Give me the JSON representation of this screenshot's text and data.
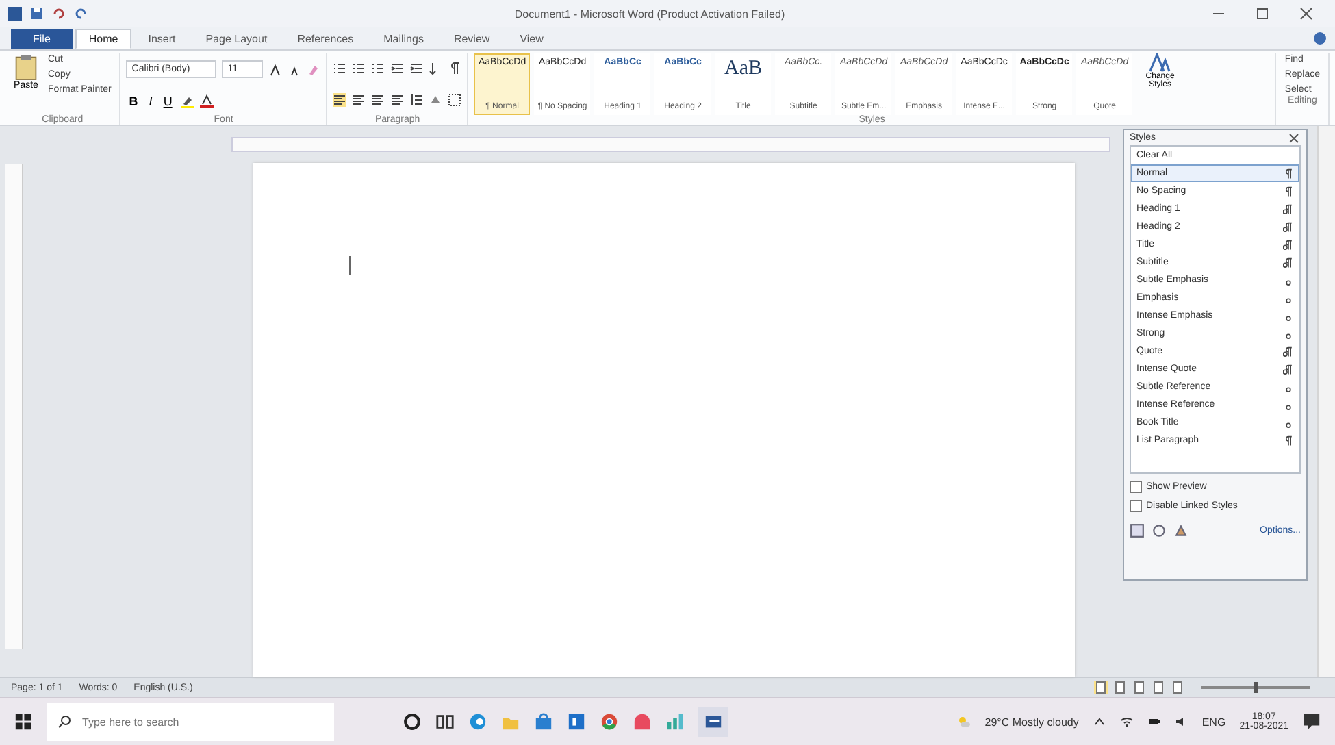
{
  "window": {
    "title": "Document1 - Microsoft Word (Product Activation Failed)"
  },
  "file_tab": "File",
  "tabs": [
    {
      "label": "Home",
      "selected": true
    },
    {
      "label": "Insert",
      "selected": false
    },
    {
      "label": "Page Layout",
      "selected": false
    },
    {
      "label": "References",
      "selected": false
    },
    {
      "label": "Mailings",
      "selected": false
    },
    {
      "label": "Review",
      "selected": false
    },
    {
      "label": "View",
      "selected": false
    }
  ],
  "clipboard": {
    "paste": "Paste",
    "cut": "Cut",
    "copy": "Copy",
    "format_painter": "Format Painter",
    "label": "Clipboard"
  },
  "font": {
    "family": "Calibri (Body)",
    "size": "11",
    "formats": [
      "B",
      "I",
      "U"
    ],
    "label": "Font"
  },
  "paragraph": {
    "label": "Paragraph"
  },
  "gallery": [
    {
      "sample": "AaBbCcDd",
      "name": "¶ Normal",
      "kind": "normal",
      "selected": true
    },
    {
      "sample": "AaBbCcDd",
      "name": "¶ No Spacing",
      "kind": "normal",
      "selected": false
    },
    {
      "sample": "AaBbCc",
      "name": "Heading 1",
      "kind": "heading",
      "selected": false
    },
    {
      "sample": "AaBbCc",
      "name": "Heading 2",
      "kind": "heading",
      "selected": false
    },
    {
      "sample": "AaB",
      "name": "Title",
      "kind": "title",
      "selected": false
    },
    {
      "sample": "AaBbCc.",
      "name": "Subtitle",
      "kind": "emphasis",
      "selected": false
    },
    {
      "sample": "AaBbCcDd",
      "name": "Subtle Em...",
      "kind": "emphasis",
      "selected": false
    },
    {
      "sample": "AaBbCcDd",
      "name": "Emphasis",
      "kind": "emphasis",
      "selected": false
    },
    {
      "sample": "AaBbCcDc",
      "name": "Intense E...",
      "kind": "normal",
      "selected": false
    },
    {
      "sample": "AaBbCcDc",
      "name": "Strong",
      "kind": "strong",
      "selected": false
    },
    {
      "sample": "AaBbCcDd",
      "name": "Quote",
      "kind": "emphasis",
      "selected": false
    }
  ],
  "styles_group": {
    "change_styles": "Change Styles",
    "label": "Styles"
  },
  "editing": {
    "items": [
      "Find",
      "Replace",
      "Select"
    ],
    "label": "Editing"
  },
  "styles_pane": {
    "title": "Styles",
    "clear_all": "Clear All",
    "items": [
      {
        "name": "Normal",
        "kind": "paragraph",
        "selected": true
      },
      {
        "name": "No Spacing",
        "kind": "paragraph",
        "selected": false
      },
      {
        "name": "Heading 1",
        "kind": "linked",
        "selected": false
      },
      {
        "name": "Heading 2",
        "kind": "linked",
        "selected": false
      },
      {
        "name": "Title",
        "kind": "linked",
        "selected": false
      },
      {
        "name": "Subtitle",
        "kind": "linked",
        "selected": false
      },
      {
        "name": "Subtle Emphasis",
        "kind": "character",
        "selected": false
      },
      {
        "name": "Emphasis",
        "kind": "character",
        "selected": false
      },
      {
        "name": "Intense Emphasis",
        "kind": "character",
        "selected": false
      },
      {
        "name": "Strong",
        "kind": "character",
        "selected": false
      },
      {
        "name": "Quote",
        "kind": "linked",
        "selected": false
      },
      {
        "name": "Intense Quote",
        "kind": "linked",
        "selected": false
      },
      {
        "name": "Subtle Reference",
        "kind": "character",
        "selected": false
      },
      {
        "name": "Intense Reference",
        "kind": "character",
        "selected": false
      },
      {
        "name": "Book Title",
        "kind": "character",
        "selected": false
      },
      {
        "name": "List Paragraph",
        "kind": "paragraph",
        "selected": false
      }
    ],
    "options": [
      {
        "label": "Show Preview",
        "checked": false
      },
      {
        "label": "Disable Linked Styles",
        "checked": false
      }
    ],
    "options_link": "Options..."
  },
  "status_bar": {
    "page": "Page: 1 of 1",
    "words": "Words: 0",
    "language": "English (U.S.)",
    "zoom": {
      "level": 0.5
    }
  },
  "taskbar": {
    "search_placeholder": "Type here to search",
    "weather": "29°C  Mostly cloudy",
    "language": "ENG",
    "time": "18:07",
    "date": "21-08-2021"
  }
}
